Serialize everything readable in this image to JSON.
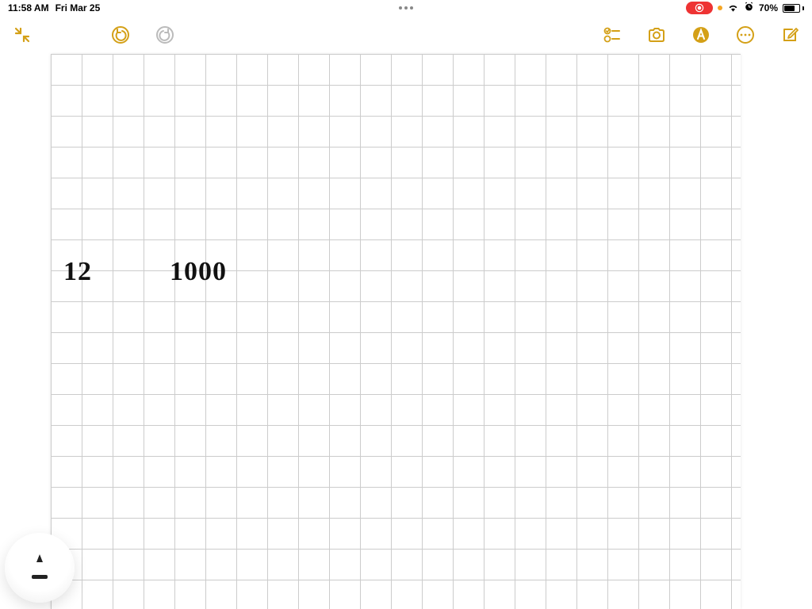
{
  "status": {
    "time": "11:58 AM",
    "date": "Fri Mar 25",
    "battery_pct": "70%"
  },
  "toolbar": {
    "collapse_label": "collapse",
    "undo_label": "undo",
    "redo_label": "redo",
    "checklist_label": "checklist",
    "camera_label": "camera",
    "markup_label": "markup",
    "more_label": "more",
    "compose_label": "compose"
  },
  "canvas": {
    "text1": "12",
    "text2": "1000"
  },
  "tools": {
    "pen_label": "pen"
  }
}
